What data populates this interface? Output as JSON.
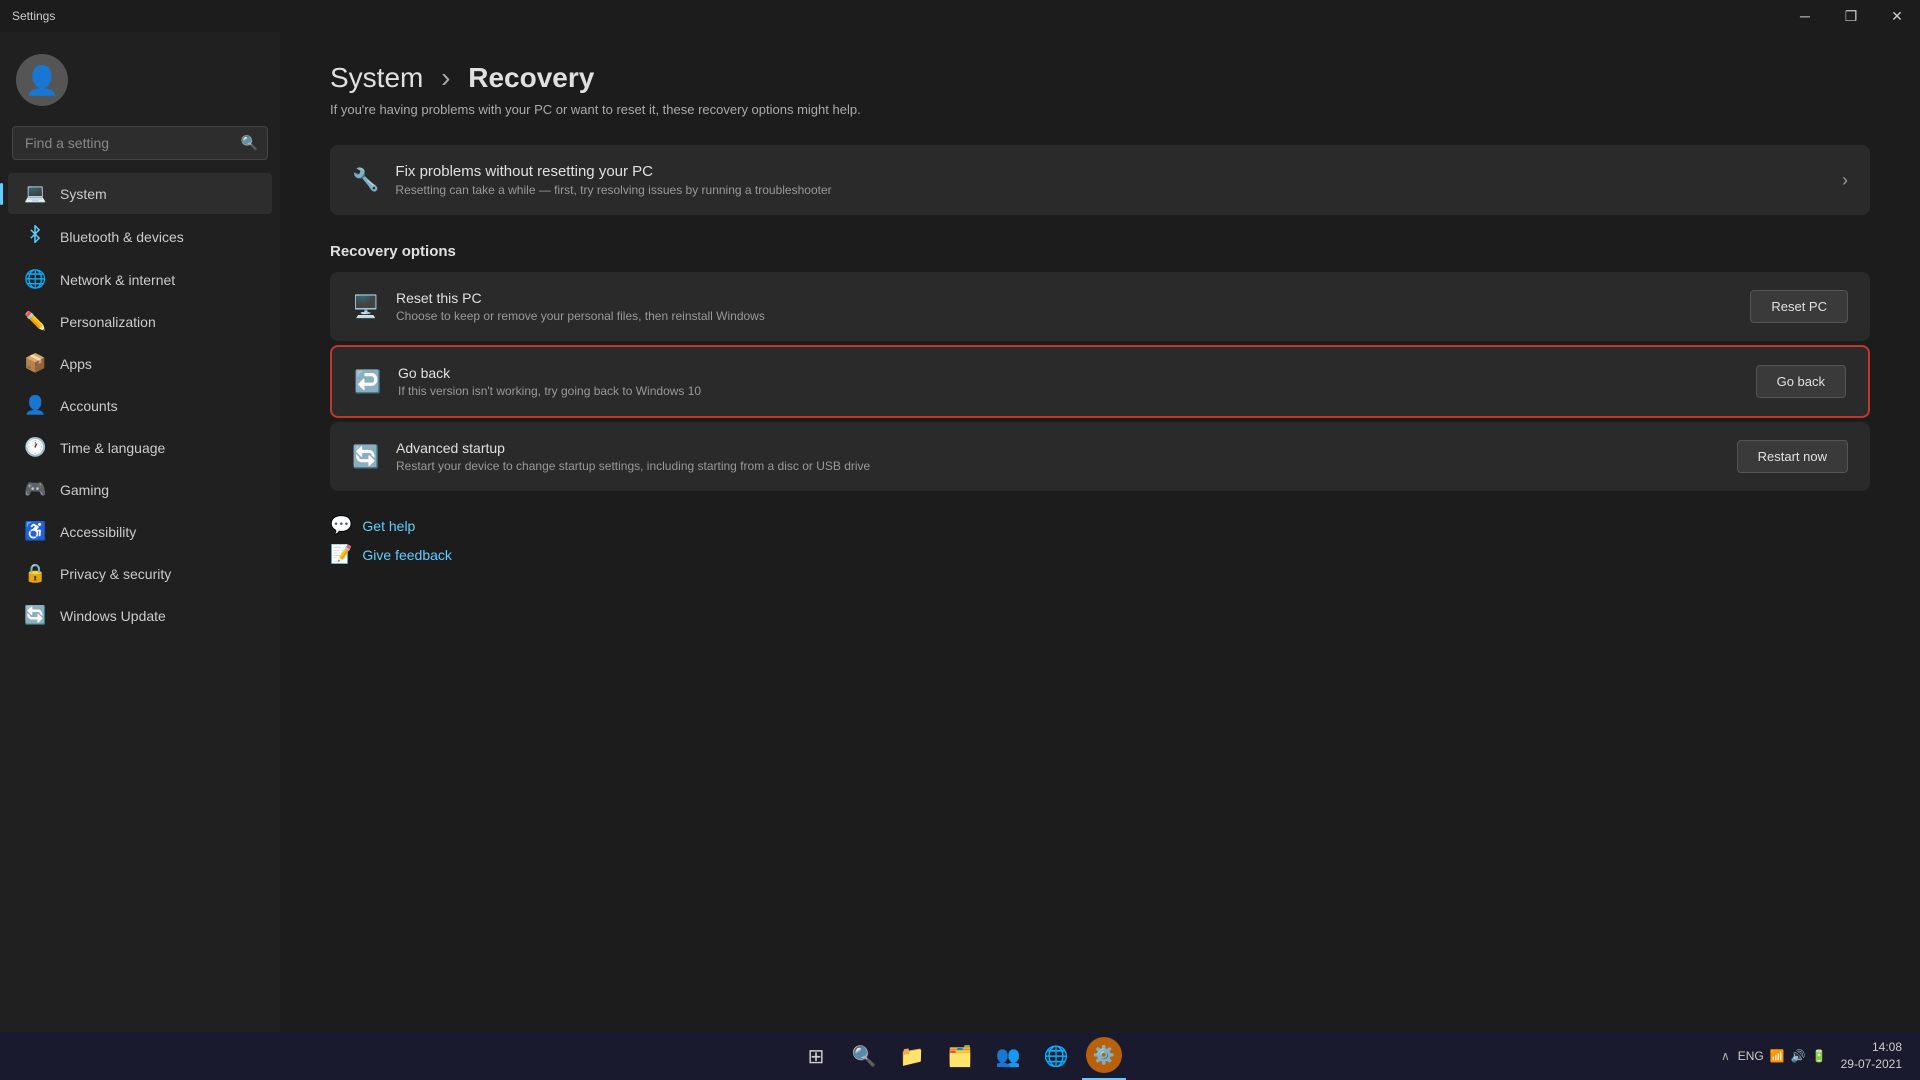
{
  "window": {
    "title": "Settings",
    "controls": {
      "minimize": "─",
      "maximize": "❐",
      "close": "✕"
    }
  },
  "sidebar": {
    "search_placeholder": "Find a setting",
    "nav_items": [
      {
        "id": "system",
        "label": "System",
        "icon": "💻",
        "icon_class": "blue",
        "active": true
      },
      {
        "id": "bluetooth",
        "label": "Bluetooth & devices",
        "icon": "🔷",
        "icon_class": "blue",
        "active": false
      },
      {
        "id": "network",
        "label": "Network & internet",
        "icon": "🌐",
        "icon_class": "blue",
        "active": false
      },
      {
        "id": "personalization",
        "label": "Personalization",
        "icon": "✏️",
        "icon_class": "gray",
        "active": false
      },
      {
        "id": "apps",
        "label": "Apps",
        "icon": "📦",
        "icon_class": "blue",
        "active": false
      },
      {
        "id": "accounts",
        "label": "Accounts",
        "icon": "👤",
        "icon_class": "blue",
        "active": false
      },
      {
        "id": "time",
        "label": "Time & language",
        "icon": "🕐",
        "icon_class": "blue",
        "active": false
      },
      {
        "id": "gaming",
        "label": "Gaming",
        "icon": "🎮",
        "icon_class": "green",
        "active": false
      },
      {
        "id": "accessibility",
        "label": "Accessibility",
        "icon": "♿",
        "icon_class": "blue",
        "active": false
      },
      {
        "id": "privacy",
        "label": "Privacy & security",
        "icon": "🔒",
        "icon_class": "blue",
        "active": false
      },
      {
        "id": "windows_update",
        "label": "Windows Update",
        "icon": "🔄",
        "icon_class": "blue",
        "active": false
      }
    ]
  },
  "main": {
    "breadcrumb": {
      "parent": "System",
      "separator": "›",
      "current": "Recovery"
    },
    "description": "If you're having problems with your PC or want to reset it, these recovery options might help.",
    "fix_card": {
      "title": "Fix problems without resetting your PC",
      "description": "Resetting can take a while — first, try resolving issues by running a troubleshooter"
    },
    "recovery_options_title": "Recovery options",
    "options": [
      {
        "id": "reset",
        "title": "Reset this PC",
        "description": "Choose to keep or remove your personal files, then reinstall Windows",
        "button_label": "Reset PC",
        "highlighted": false
      },
      {
        "id": "go_back",
        "title": "Go back",
        "description": "If this version isn't working, try going back to Windows 10",
        "button_label": "Go back",
        "highlighted": true
      },
      {
        "id": "advanced_startup",
        "title": "Advanced startup",
        "description": "Restart your device to change startup settings, including starting from a disc or USB drive",
        "button_label": "Restart now",
        "highlighted": false
      }
    ],
    "links": [
      {
        "id": "get_help",
        "label": "Get help"
      },
      {
        "id": "give_feedback",
        "label": "Give feedback"
      }
    ]
  },
  "taskbar": {
    "start_icon": "⊞",
    "search_icon": "🔍",
    "apps": [
      {
        "id": "file_explorer",
        "icon": "📁"
      },
      {
        "id": "store",
        "icon": "🗂️"
      },
      {
        "id": "teams",
        "icon": "👥"
      },
      {
        "id": "edge",
        "icon": "🌐"
      },
      {
        "id": "settings",
        "icon": "⚙️",
        "active": true
      }
    ],
    "system_tray": {
      "language": "ENG",
      "chevron": "∧",
      "wifi": "📶",
      "volume": "🔊",
      "battery": "🔋",
      "time": "14:08",
      "date": "29-07-2021"
    }
  }
}
